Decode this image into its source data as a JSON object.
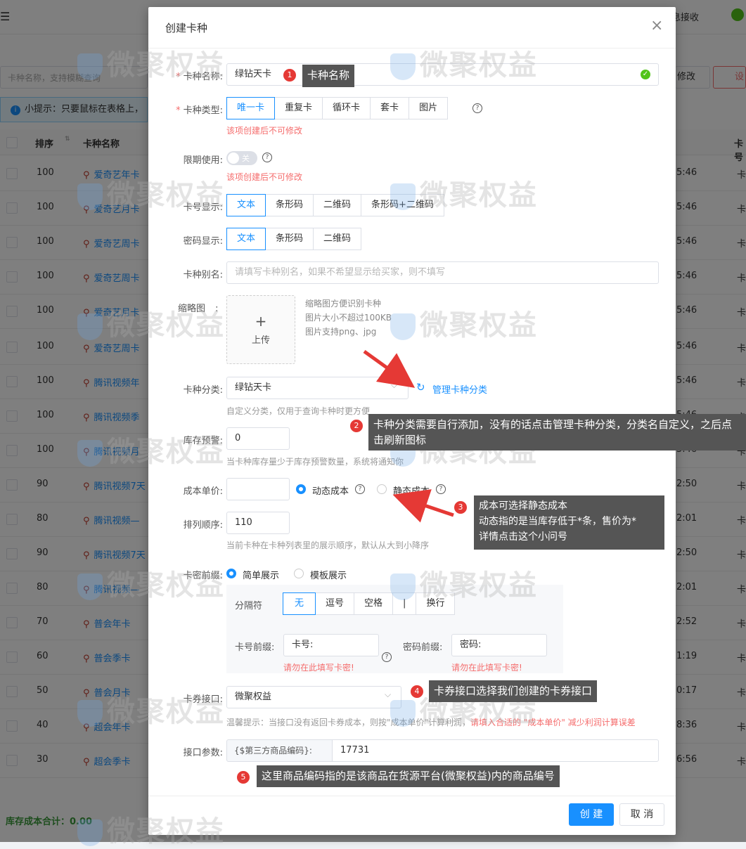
{
  "background": {
    "topbar_right": "息接收",
    "search_placeholder": "卡种名称，支持模糊查询",
    "btn_modify": "修改",
    "btn_right": "设",
    "tip": "小提示：只要鼠标在表格上，",
    "tip_icon": "i",
    "headers": {
      "rank": "排序",
      "name": "卡种名称",
      "card": "卡号"
    },
    "rows": [
      {
        "rank": "100",
        "name": "爱奇艺年卡",
        "time": "5:46",
        "card": "卡"
      },
      {
        "rank": "100",
        "name": "爱奇艺月卡",
        "time": "5:46",
        "card": "卡"
      },
      {
        "rank": "100",
        "name": "爱奇艺周卡",
        "time": "5:46",
        "card": "卡"
      },
      {
        "rank": "100",
        "name": "爱奇艺周卡",
        "time": "5:46",
        "card": "卡"
      },
      {
        "rank": "100",
        "name": "爱奇艺月卡",
        "time": "5:46",
        "card": "卡"
      },
      {
        "rank": "100",
        "name": "爱奇艺周卡",
        "time": "5:46",
        "card": "卡"
      },
      {
        "rank": "100",
        "name": "腾讯视频年",
        "time": "5:46",
        "card": "卡"
      },
      {
        "rank": "100",
        "name": "腾讯视频季",
        "time": "5:46",
        "card": "卡"
      },
      {
        "rank": "100",
        "name": "腾讯视频月",
        "time": "5:46",
        "card": "卡"
      },
      {
        "rank": "90",
        "name": "腾讯视频7天",
        "time": "2:50",
        "card": "卡"
      },
      {
        "rank": "80",
        "name": "腾讯视频—",
        "time": "2:01",
        "card": "卡"
      },
      {
        "rank": "90",
        "name": "腾讯视频7天",
        "time": "2:50",
        "card": "卡"
      },
      {
        "rank": "80",
        "name": "腾讯视频—",
        "time": "2:01",
        "card": "卡"
      },
      {
        "rank": "70",
        "name": "普会年卡",
        "time": "2:52",
        "card": "卡"
      },
      {
        "rank": "60",
        "name": "普会季卡",
        "time": "1:19",
        "card": "卡"
      },
      {
        "rank": "50",
        "name": "普会月卡",
        "time": "0:17",
        "card": "卡"
      },
      {
        "rank": "40",
        "name": "超会年卡",
        "time": "8:36",
        "card": "卡"
      },
      {
        "rank": "30",
        "name": "超会季卡",
        "time": "6:56",
        "card": "卡"
      }
    ],
    "footer": "库存成本合计：0.00"
  },
  "dialog": {
    "title": "创建卡种",
    "close": "×",
    "name_label": "卡种名称:",
    "name_value": "绿钻天卡",
    "type_label": "卡种类型:",
    "type_options": [
      "唯一卡",
      "重复卡",
      "循环卡",
      "套卡",
      "图片"
    ],
    "type_error": "该项创建后不可修改",
    "limit_label": "限期使用:",
    "limit_toggle": "关",
    "limit_error": "该项创建后不可修改",
    "cardno_label": "卡号显示:",
    "cardno_options": [
      "文本",
      "条形码",
      "二维码",
      "条形码+二维码"
    ],
    "pwd_label": "密码显示:",
    "pwd_options": [
      "文本",
      "条形码",
      "二维码"
    ],
    "alias_label": "卡种别名:",
    "alias_placeholder": "请填写卡种别名，如果不希望显示给买家，则不填写",
    "thumb_label": "缩略图",
    "thumb_colon": ":",
    "upload_plus": "+",
    "upload_text": "上传",
    "thumb_tips": [
      "缩略图方便识别卡种",
      "图片大小不超过100KB",
      "图片支持png、jpg"
    ],
    "category_label": "卡种分类:",
    "category_value": "绿钻天卡",
    "category_manage": "管理卡种分类",
    "category_hint": "自定义分类，仅用于查询卡种时更方便",
    "stock_label": "库存预警:",
    "stock_value": "0",
    "stock_hint": "当卡种库存量少于库存预警数量，系统将通知你",
    "cost_label": "成本单价:",
    "cost_dynamic": "动态成本",
    "cost_static": "静态成本",
    "sort_label": "排列顺序:",
    "sort_value": "110",
    "sort_hint": "当前卡种在卡种列表里的展示顺序，默认从大到小降序",
    "prefix_label": "卡密前缀:",
    "prefix_simple": "简单展示",
    "prefix_template": "模板展示",
    "sep_label": "分隔符",
    "sep_options": [
      "无",
      "逗号",
      "空格",
      "|",
      "换行"
    ],
    "cardno_prefix_label": "卡号前缀:",
    "cardno_prefix_value": "卡号:",
    "cardno_prefix_warn": "请勿在此填写卡密!",
    "pwd_prefix_label": "密码前缀:",
    "pwd_prefix_value": "密码:",
    "pwd_prefix_warn": "请勿在此填写卡密!",
    "api_label": "卡券接口:",
    "api_value": "微聚权益",
    "api_hint_gray": "温馨提示：当接口没有返回卡券成本，则按\"成本单价\"计算利润，",
    "api_hint_red": "请填入合适的 \"成本单价\" 减少利润计算误差",
    "param_label": "接口参数:",
    "param_addon": "{$第三方商品编码}:",
    "param_value": "17731",
    "btn_create": "创 建",
    "btn_cancel": "取 消"
  },
  "annotations": [
    {
      "num": "1",
      "text": "卡种名称"
    },
    {
      "num": "2",
      "text": "卡种分类需要自行添加，没有的话点击管理卡种分类，分类名自定义，之后点击刷新图标"
    },
    {
      "num": "3",
      "text": "成本可选择静态成本\n动态指的是当库存低于*条，售价为*\n详情点击这个小问号"
    },
    {
      "num": "4",
      "text": "卡券接口选择我们创建的卡券接口"
    },
    {
      "num": "5",
      "text": "这里商品编码指的是该商品在货源平台(微聚权益)内的商品编号"
    }
  ],
  "watermark": "微聚权益",
  "colors": {
    "accent": "#1890ff",
    "error": "#f56c6c",
    "annotation": "#555555",
    "badge": "#e53935",
    "success": "#52c41a"
  }
}
